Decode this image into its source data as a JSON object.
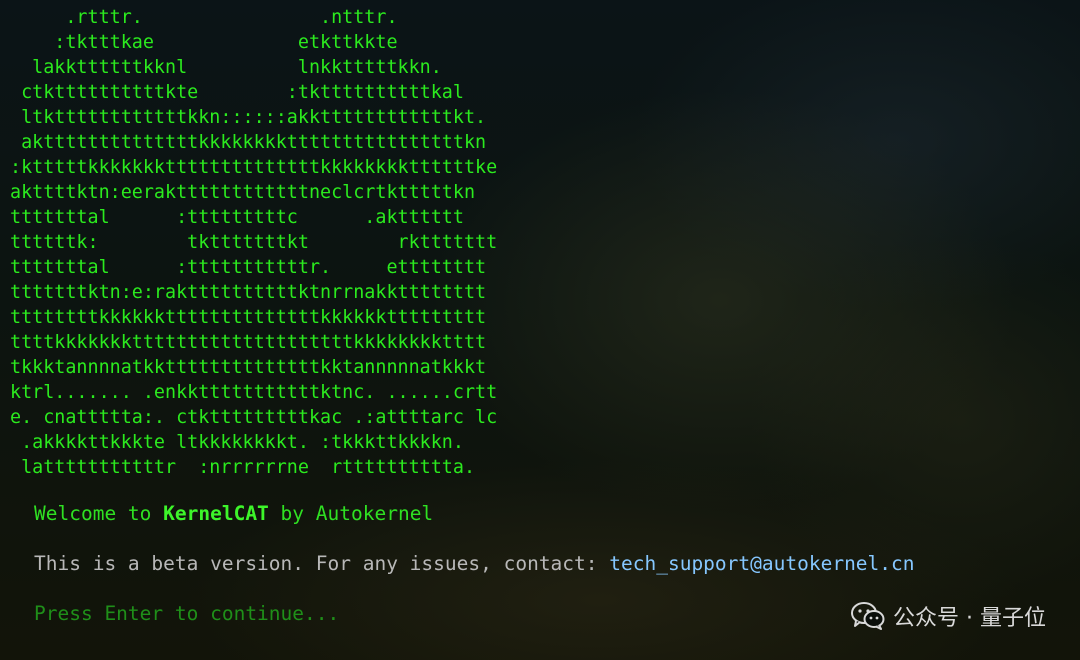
{
  "ascii_art": {
    "lines": [
      "     .rtttr.                .ntttr.",
      "    :tktttkae             etkttkkte",
      "  lakkttttttkknl          lnkktttttkkn.",
      " ctkttttttttttkte        :tkttttttttttkal",
      " ltkttttttttttttkkn::::::akkttttttttttttkt.",
      " akttttttttttttttkkkkkkkkttttttttttttttttkn",
      ":ktttttkkkkkkkttttttttttttttkkkkkkkkttttttke",
      "akttttktn:eerakttttttttttttneclcrtktttttkn",
      "tttttttal      :tttttttttc      .aktttttt",
      "ttttttk:        tktttttttkt        rkttttttt",
      "tttttttal      :tttttttttttr.     etttttttt",
      "tttttttktn:e:rakttttttttttktnrrnakktttttttt",
      "ttttttttkkkkkkttttttttttttttkkkkkkttttttttt",
      "ttttkkkkkkkttttttttttttttttttttkkkkkkkktttt",
      "tkkktannnnatkkttttttttttttttkktannnnnatkkkt",
      "ktrl....... .enkktttttttttttktnc. ......crtt",
      "e. cnattttta:. ctktttttttttkac .:attttarc lc",
      " .akkkkttkkkte ltkkkkkkkkt. :tkkkttkkkkn.",
      " latttttttttttr  :nrrrrrrne  rtttttttttta."
    ]
  },
  "welcome": {
    "prefix": "Welcome to ",
    "brand": "KernelCAT",
    "suffix": " by Autokernel"
  },
  "beta_notice": {
    "text": "This is a beta version. For any issues, contact: ",
    "email": "tech_support@autokernel.cn"
  },
  "prompt": {
    "text": "Press Enter to continue..."
  },
  "watermark": {
    "icon": "wechat-icon",
    "text": "公众号 · 量子位"
  }
}
